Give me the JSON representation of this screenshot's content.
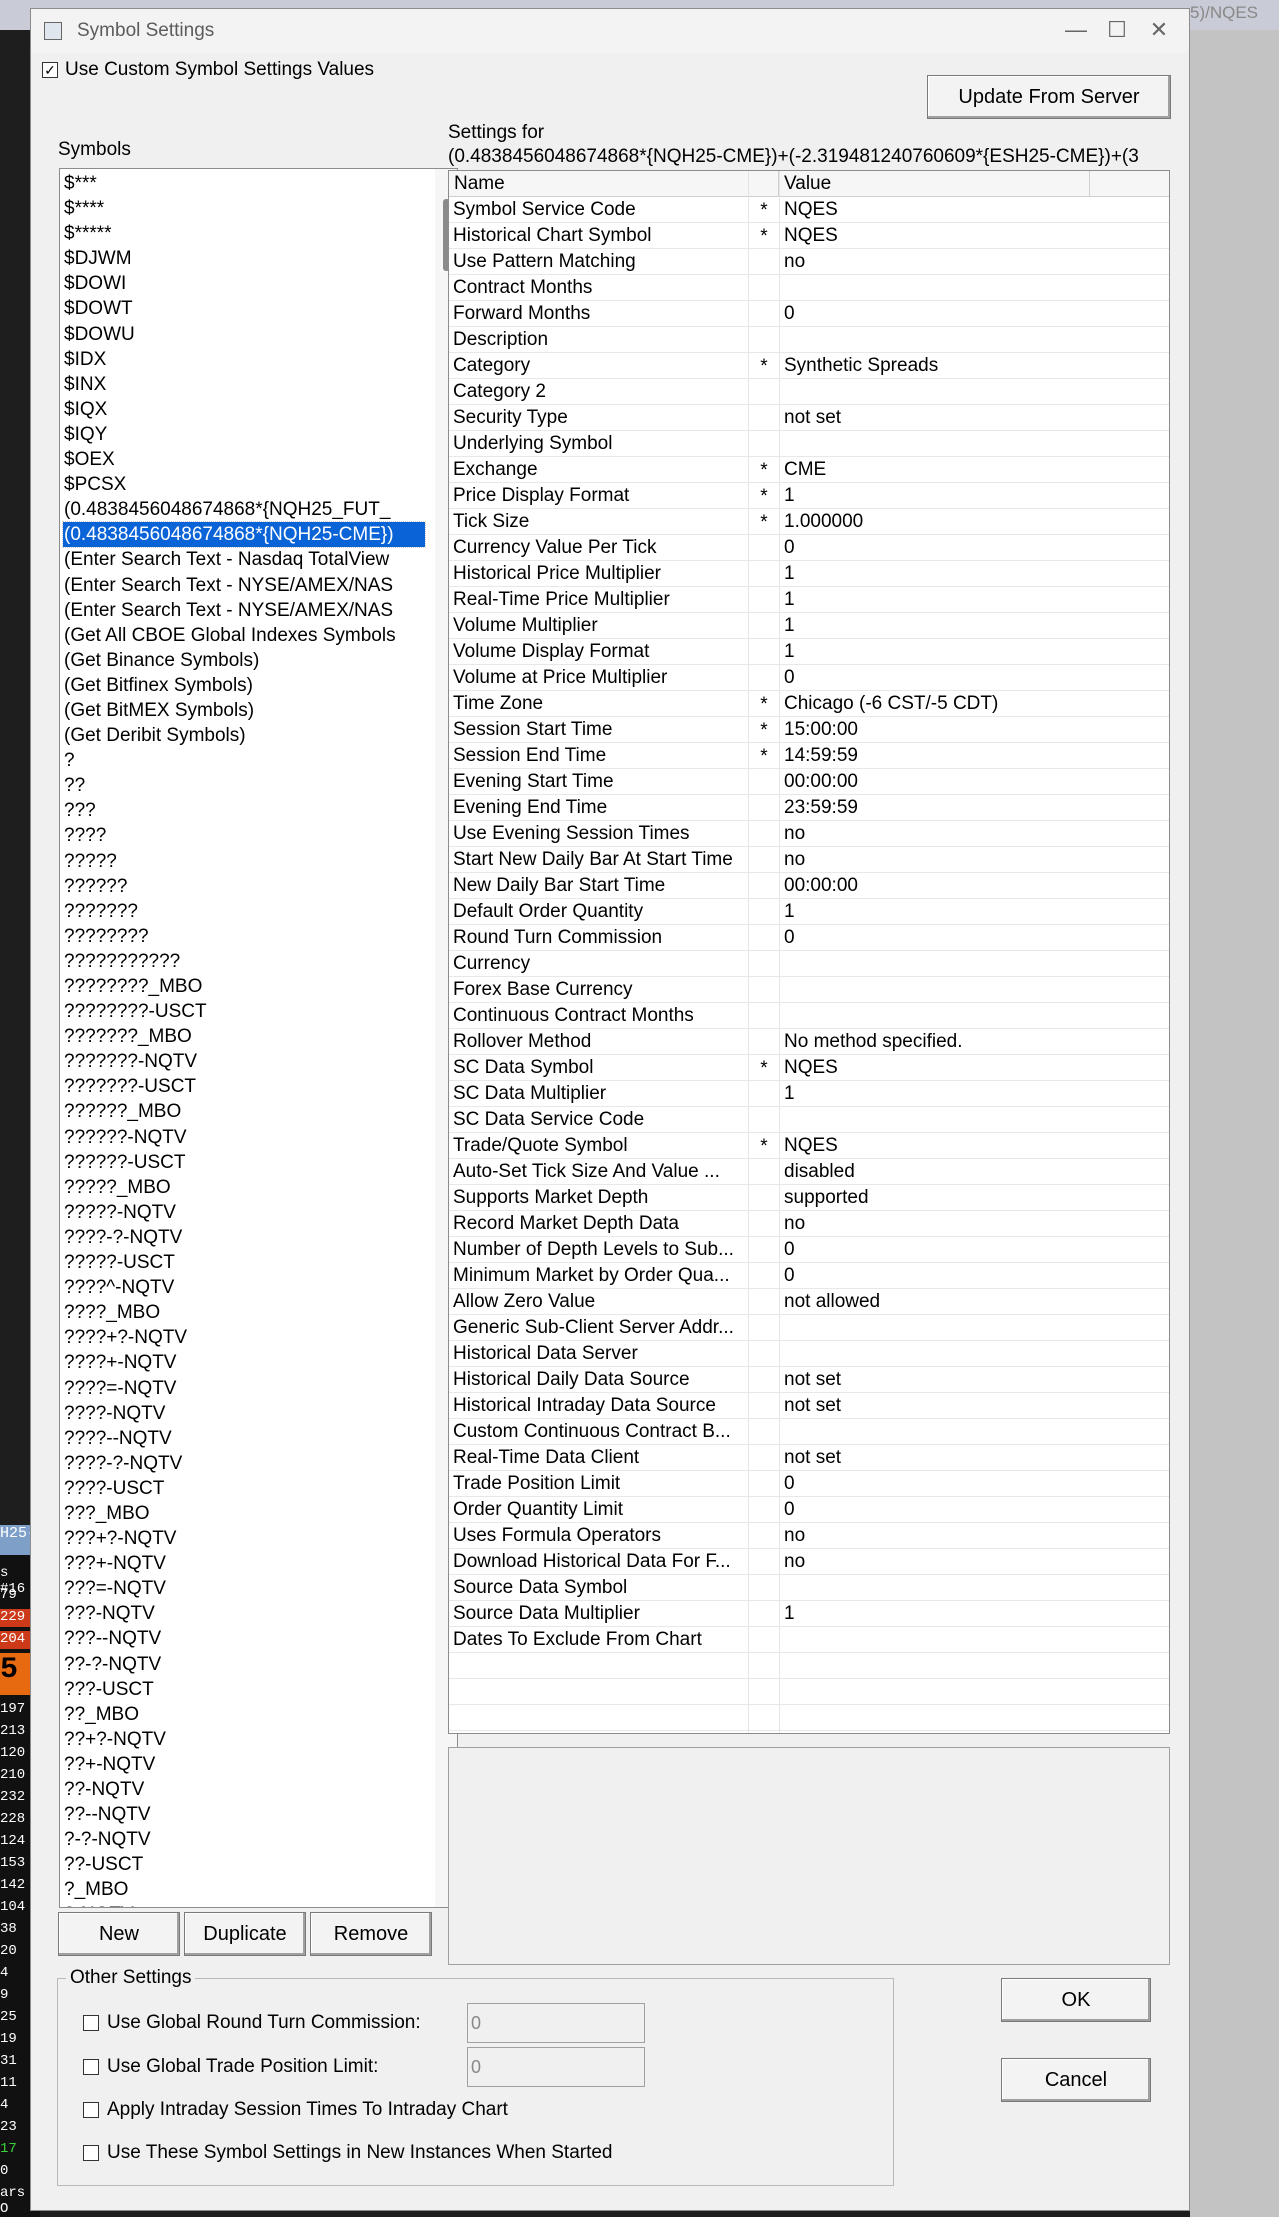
{
  "background": {
    "title_fragment": "5)/NQES",
    "left_strip": [
      {
        "text": "H25-",
        "kind": "lbl"
      },
      {
        "text": "s #16",
        "kind": "normal"
      },
      {
        "text": "79",
        "kind": "normal"
      },
      {
        "text": "229",
        "kind": "red"
      },
      {
        "text": "204",
        "kind": "red"
      },
      {
        "text": "5",
        "kind": "orange"
      },
      {
        "text": "197",
        "kind": "normal"
      },
      {
        "text": "213",
        "kind": "normal"
      },
      {
        "text": "120",
        "kind": "normal"
      },
      {
        "text": "210",
        "kind": "normal"
      },
      {
        "text": "232",
        "kind": "normal"
      },
      {
        "text": "228",
        "kind": "normal"
      },
      {
        "text": "124",
        "kind": "normal"
      },
      {
        "text": "153",
        "kind": "normal"
      },
      {
        "text": "142",
        "kind": "normal"
      },
      {
        "text": "104",
        "kind": "normal"
      },
      {
        "text": "38",
        "kind": "normal"
      },
      {
        "text": "20",
        "kind": "normal"
      },
      {
        "text": "4",
        "kind": "normal"
      },
      {
        "text": "9",
        "kind": "normal"
      },
      {
        "text": "25",
        "kind": "normal"
      },
      {
        "text": "19",
        "kind": "normal"
      },
      {
        "text": "31",
        "kind": "normal"
      },
      {
        "text": "11",
        "kind": "normal"
      },
      {
        "text": "4",
        "kind": "normal"
      },
      {
        "text": "23",
        "kind": "normal"
      },
      {
        "text": "17",
        "kind": "green"
      },
      {
        "text": "0",
        "kind": "normal"
      },
      {
        "text": "ars O",
        "kind": "normal"
      }
    ]
  },
  "window": {
    "title": "Symbol Settings",
    "minimize": "—",
    "maximize": "☐",
    "close": "✕"
  },
  "use_custom": {
    "label": "Use Custom Symbol Settings Values",
    "checked": "✓"
  },
  "update_button": "Update From Server",
  "symbols_label": "Symbols",
  "symbols": [
    "$***",
    "$****",
    "$*****",
    "$DJWM",
    "$DOWI",
    "$DOWT",
    "$DOWU",
    "$IDX",
    "$INX",
    "$IQX",
    "$IQY",
    "$OEX",
    "$PCSX",
    "(0.4838456048674868*{NQH25_FUT_",
    "(0.4838456048674868*{NQH25-CME})",
    "(Enter Search Text - Nasdaq TotalView",
    "(Enter Search Text - NYSE/AMEX/NAS",
    "(Enter Search Text - NYSE/AMEX/NAS",
    "(Get All CBOE Global Indexes Symbols",
    "(Get Binance Symbols)",
    "(Get Bitfinex Symbols)",
    "(Get BitMEX Symbols)",
    "(Get Deribit Symbols)",
    "?",
    "??",
    "???",
    "????",
    "?????",
    "??????",
    "???????",
    "????????",
    "???????????",
    "????????_MBO",
    "????????-USCT",
    "???????_MBO",
    "???????-NQTV",
    "???????-USCT",
    "??????_MBO",
    "??????-NQTV",
    "??????-USCT",
    "?????_MBO",
    "?????-NQTV",
    "????-?-NQTV",
    "?????-USCT",
    "????^-NQTV",
    "????_MBO",
    "????+?-NQTV",
    "????+-NQTV",
    "????=-NQTV",
    "????-NQTV",
    "????--NQTV",
    "????-?-NQTV",
    "????-USCT",
    "???_MBO",
    "???+?-NQTV",
    "???+-NQTV",
    "???=-NQTV",
    "???-NQTV",
    "???--NQTV",
    "??-?-NQTV",
    "???-USCT",
    "??_MBO",
    "??+?-NQTV",
    "??+-NQTV",
    "??-NQTV",
    "??--NQTV",
    "?-?-NQTV",
    "??-USCT",
    "?_MBO",
    "?-NQTV"
  ],
  "selected_symbol_index": 14,
  "list_buttons": {
    "new": "New",
    "duplicate": "Duplicate",
    "remove": "Remove"
  },
  "settings_for_label": "Settings for",
  "settings_expression": "(0.4838456048674868*{NQH25-CME})+(-2.319481240760609*{ESH25-CME})+(3",
  "grid_headers": {
    "name": "Name",
    "value": "Value"
  },
  "settings": [
    {
      "name": "Symbol Service Code",
      "star": "*",
      "value": "NQES"
    },
    {
      "name": "Historical Chart Symbol",
      "star": "*",
      "value": "NQES"
    },
    {
      "name": "Use Pattern Matching",
      "star": "",
      "value": "no"
    },
    {
      "name": "Contract Months",
      "star": "",
      "value": ""
    },
    {
      "name": "Forward Months",
      "star": "",
      "value": "0"
    },
    {
      "name": "Description",
      "star": "",
      "value": ""
    },
    {
      "name": "Category",
      "star": "*",
      "value": "Synthetic Spreads"
    },
    {
      "name": "Category 2",
      "star": "",
      "value": ""
    },
    {
      "name": "Security Type",
      "star": "",
      "value": "not set"
    },
    {
      "name": "Underlying Symbol",
      "star": "",
      "value": ""
    },
    {
      "name": "Exchange",
      "star": "*",
      "value": "CME"
    },
    {
      "name": "Price Display Format",
      "star": "*",
      "value": "1"
    },
    {
      "name": "Tick Size",
      "star": "*",
      "value": "1.000000"
    },
    {
      "name": "Currency Value Per Tick",
      "star": "",
      "value": "0"
    },
    {
      "name": "Historical Price Multiplier",
      "star": "",
      "value": "1"
    },
    {
      "name": "Real-Time Price Multiplier",
      "star": "",
      "value": "1"
    },
    {
      "name": "Volume Multiplier",
      "star": "",
      "value": "1"
    },
    {
      "name": "Volume Display Format",
      "star": "",
      "value": "1"
    },
    {
      "name": "Volume at Price Multiplier",
      "star": "",
      "value": "0"
    },
    {
      "name": "Time Zone",
      "star": "*",
      "value": "Chicago (-6 CST/-5 CDT)"
    },
    {
      "name": "Session Start Time",
      "star": "*",
      "value": "15:00:00"
    },
    {
      "name": "Session End Time",
      "star": "*",
      "value": "14:59:59"
    },
    {
      "name": "Evening Start Time",
      "star": "",
      "value": "00:00:00"
    },
    {
      "name": "Evening End Time",
      "star": "",
      "value": "23:59:59"
    },
    {
      "name": "Use Evening Session Times",
      "star": "",
      "value": "no"
    },
    {
      "name": "Start New Daily Bar At Start Time",
      "star": "",
      "value": "no"
    },
    {
      "name": "New Daily Bar Start Time",
      "star": "",
      "value": "00:00:00"
    },
    {
      "name": "Default Order Quantity",
      "star": "",
      "value": "1"
    },
    {
      "name": "Round Turn Commission",
      "star": "",
      "value": "0"
    },
    {
      "name": "Currency",
      "star": "",
      "value": ""
    },
    {
      "name": "Forex Base Currency",
      "star": "",
      "value": ""
    },
    {
      "name": "Continuous Contract Months",
      "star": "",
      "value": ""
    },
    {
      "name": "Rollover Method",
      "star": "",
      "value": "No method specified."
    },
    {
      "name": "SC Data Symbol",
      "star": "*",
      "value": "NQES"
    },
    {
      "name": "SC Data Multiplier",
      "star": "",
      "value": "1"
    },
    {
      "name": "SC Data Service Code",
      "star": "",
      "value": ""
    },
    {
      "name": "Trade/Quote Symbol",
      "star": "*",
      "value": "NQES"
    },
    {
      "name": "Auto-Set Tick Size And Value ...",
      "star": "",
      "value": "disabled"
    },
    {
      "name": "Supports Market Depth",
      "star": "",
      "value": "supported"
    },
    {
      "name": "Record Market Depth Data",
      "star": "",
      "value": "no"
    },
    {
      "name": "Number of Depth Levels to Sub...",
      "star": "",
      "value": "0"
    },
    {
      "name": "Minimum Market by Order Qua...",
      "star": "",
      "value": "0"
    },
    {
      "name": "Allow Zero Value",
      "star": "",
      "value": "not allowed"
    },
    {
      "name": "Generic Sub-Client Server Addr...",
      "star": "",
      "value": ""
    },
    {
      "name": "Historical Data Server",
      "star": "",
      "value": ""
    },
    {
      "name": "Historical Daily Data Source",
      "star": "",
      "value": "not set"
    },
    {
      "name": "Historical Intraday Data Source",
      "star": "",
      "value": "not set"
    },
    {
      "name": "Custom Continuous Contract B...",
      "star": "",
      "value": ""
    },
    {
      "name": "Real-Time Data Client",
      "star": "",
      "value": "not set"
    },
    {
      "name": "Trade Position Limit",
      "star": "",
      "value": "0"
    },
    {
      "name": "Order Quantity Limit",
      "star": "",
      "value": "0"
    },
    {
      "name": "Uses Formula Operators",
      "star": "",
      "value": "no"
    },
    {
      "name": "Download Historical Data For F...",
      "star": "",
      "value": "no"
    },
    {
      "name": "Source Data Symbol",
      "star": "",
      "value": ""
    },
    {
      "name": "Source Data Multiplier",
      "star": "",
      "value": "1"
    },
    {
      "name": "Dates To Exclude From Chart",
      "star": "",
      "value": ""
    }
  ],
  "other_settings": {
    "legend": "Other Settings",
    "global_commission_label": "Use Global Round Turn Commission:",
    "global_commission_value": "0",
    "global_position_label": "Use Global Trade Position Limit:",
    "global_position_value": "0",
    "apply_intraday_label": "Apply Intraday Session Times To Intraday Chart",
    "use_in_new_label": "Use These Symbol Settings in New Instances When Started"
  },
  "ok_button": "OK",
  "cancel_button": "Cancel"
}
